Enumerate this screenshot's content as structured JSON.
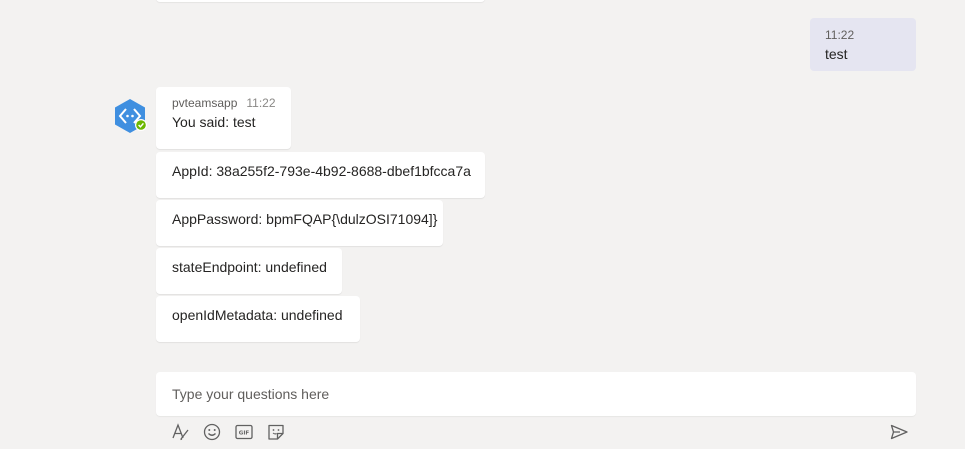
{
  "outgoing": {
    "time": "11:22",
    "text": "test"
  },
  "incoming": {
    "sender": "pvteamsapp",
    "time": "11:22",
    "messages": [
      "You said: test",
      "AppId: 38a255f2-793e-4b92-8688-dbef1bfcca7a",
      "AppPassword: bpmFQAP{\\dulzOSI71094]}",
      "stateEndpoint: undefined",
      "openIdMetadata: undefined"
    ]
  },
  "composer": {
    "placeholder": "Type your questions here"
  },
  "toolbar": {
    "icons": [
      "format-icon",
      "emoji-icon",
      "gif-icon",
      "sticker-icon",
      "send-icon"
    ]
  },
  "colors": {
    "background": "#f3f2f1",
    "outgoing_bubble": "#e5e5f1",
    "bot_avatar": "#3f8fe0",
    "presence_available": "#6bb700",
    "icon": "#616161"
  }
}
